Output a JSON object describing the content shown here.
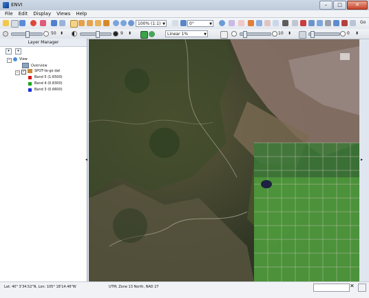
{
  "window": {
    "title": "ENVI",
    "minimize": "–",
    "maximize": "□",
    "close": "✕"
  },
  "menu": [
    "File",
    "Edit",
    "Display",
    "Views",
    "Help"
  ],
  "toolbar": {
    "zoom_value": "100% (1:1)",
    "rotation_value": "0°",
    "stretch_value": "Linear 1%",
    "go_label": "Go"
  },
  "adjust": {
    "brightness": "50",
    "contrast": "9",
    "sharpen": "10",
    "transparency": "0"
  },
  "layer_manager": {
    "title": "Layer Manager",
    "root": "View",
    "overview": "Overview",
    "file": "SPOT-te-go dat",
    "bands": [
      {
        "label": "Band 5  (1.6500)",
        "color": "#d81818"
      },
      {
        "label": "Band 4  (0.8300)",
        "color": "#18a818"
      },
      {
        "label": "Band 3  (0.6600)",
        "color": "#1a30d8"
      }
    ]
  },
  "status": {
    "location": "Lat: 40° 3'34.52\"N, Lon: 105° 18'14.46\"W",
    "projection": "UTM, Zone 13 North, NAD 27"
  }
}
